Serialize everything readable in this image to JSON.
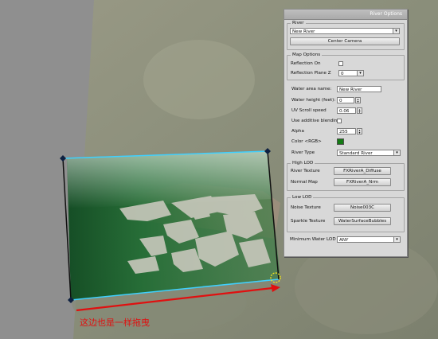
{
  "annotation": {
    "text": "这边也是一样拖曳",
    "color": "#e01010"
  },
  "panel": {
    "title": "River Options",
    "river_group": {
      "title": "River",
      "selected": "New River",
      "center_button": "Center Camera"
    },
    "map_options": {
      "title": "Map Options",
      "reflection_on_label": "Reflection On",
      "reflection_plane_label": "Reflection Plane Z",
      "reflection_plane_value": "0"
    },
    "water": {
      "area_name_label": "Water area name:",
      "area_name_value": "New River",
      "height_label": "Water height (feet):",
      "height_value": "0",
      "uv_scroll_label": "UV Scroll speed",
      "uv_scroll_value": "0.06",
      "additive_label": "Use additive blending",
      "alpha_label": "Alpha",
      "alpha_value": "255",
      "color_label": "Color <RGB>",
      "color_value": "#137a13",
      "river_type_label": "River Type",
      "river_type_value": "Standard River"
    },
    "high_lod": {
      "title": "High LOD",
      "river_texture_label": "River Texture",
      "river_texture_button": "FXRiverA_Diffuse",
      "normal_map_label": "Normal Map",
      "normal_map_button": "FXRiverA_Nrm"
    },
    "low_lod": {
      "title": "Low LOD",
      "noise_label": "Noise Texture",
      "noise_button": "Noise003C",
      "sparkle_label": "Sparkle Texture",
      "sparkle_button": "WaterSurfaceBubbles"
    },
    "min_lod_label": "Minimum Water LOD",
    "min_lod_value": "ANY"
  }
}
